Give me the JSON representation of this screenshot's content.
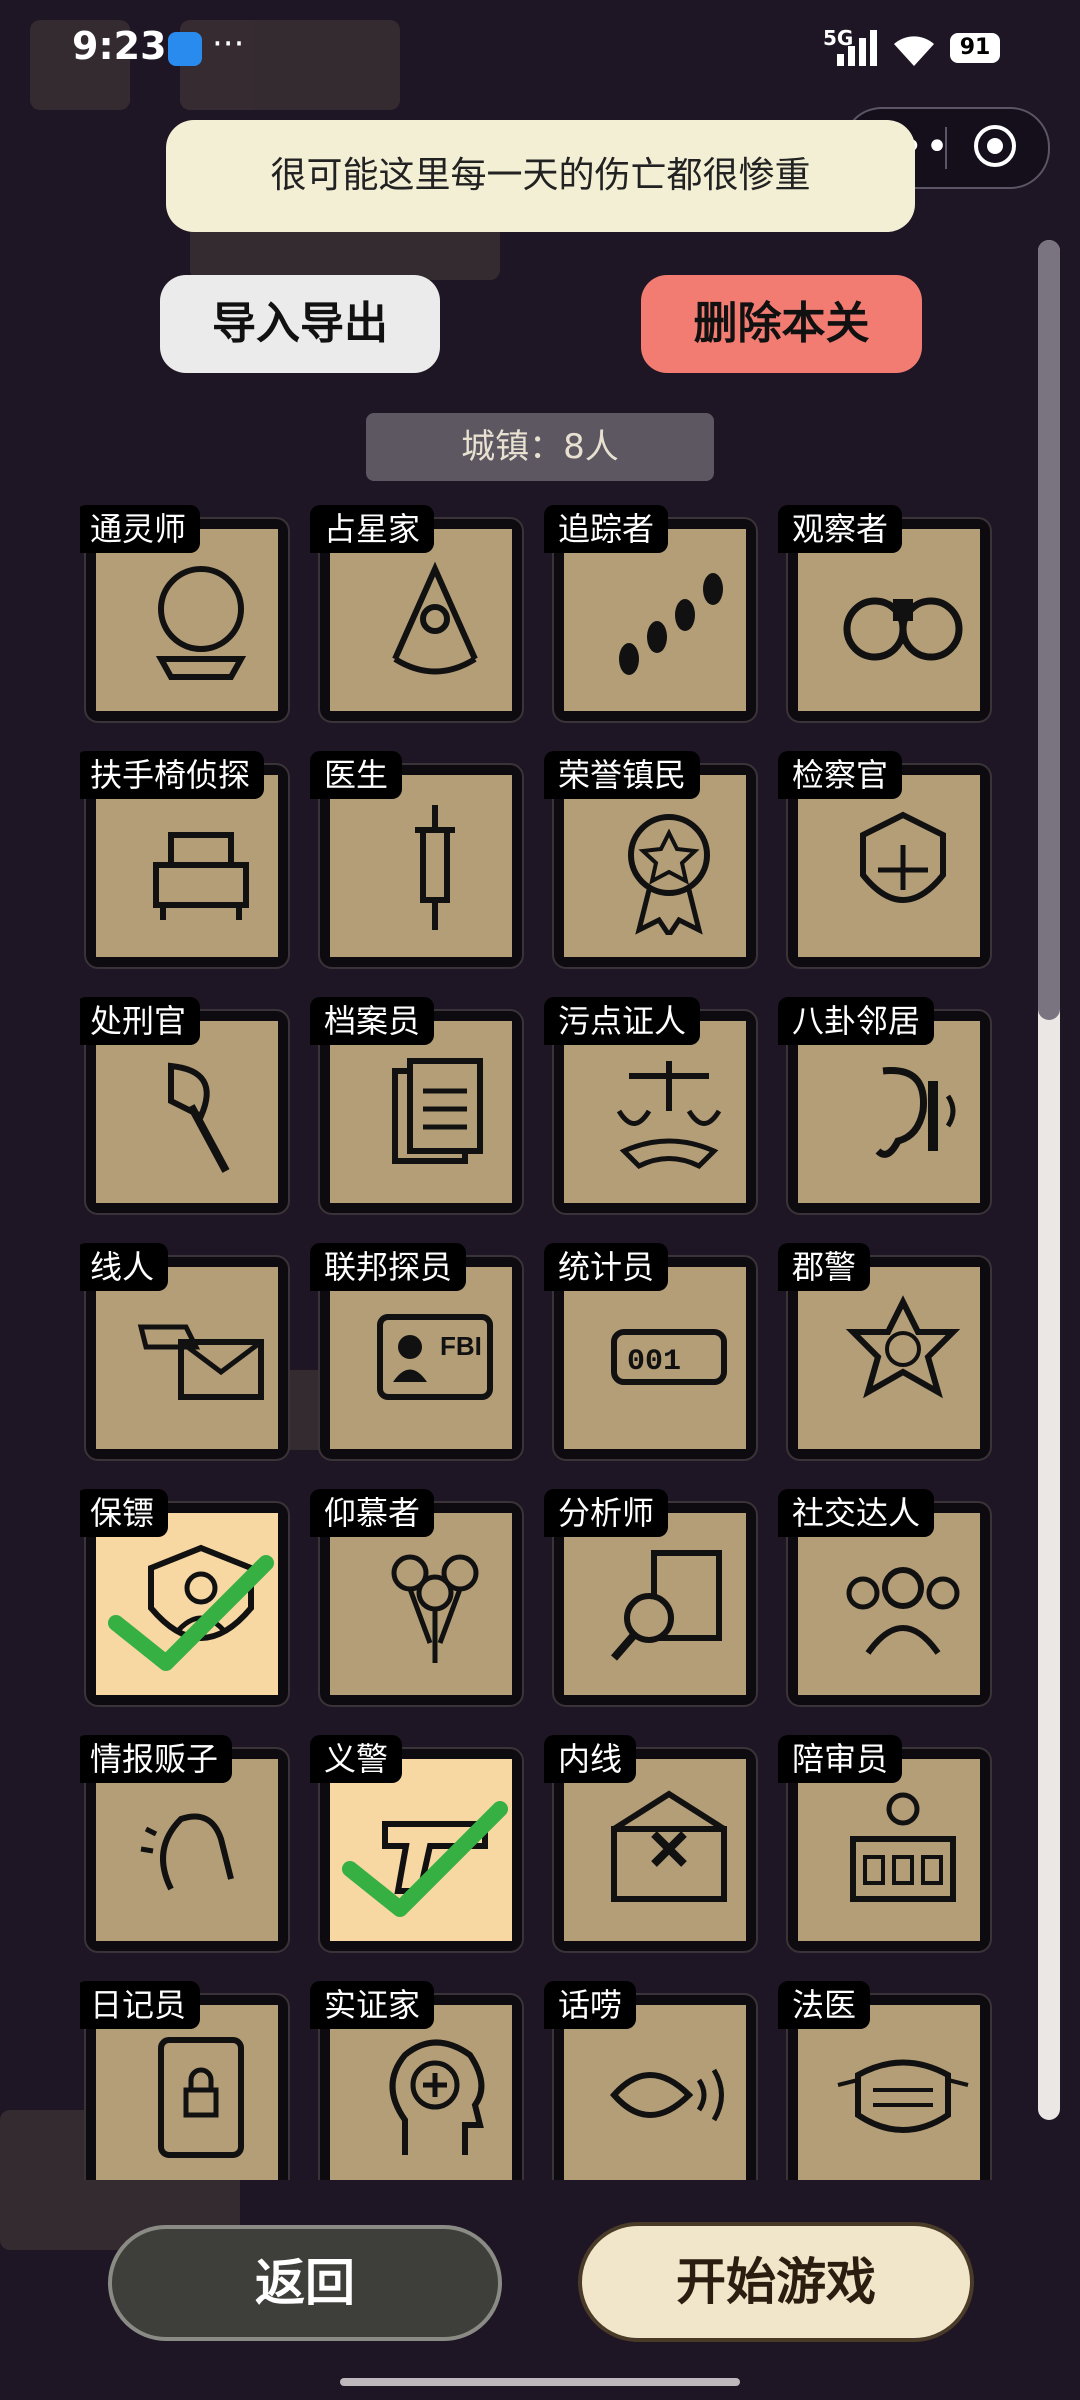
{
  "status_bar": {
    "time": "9:23",
    "network": "5G",
    "battery": "91"
  },
  "toast": "很可能这里每一天的伤亡都很惨重",
  "buttons": {
    "import_export": "导入导出",
    "delete_level": "删除本关",
    "back": "返回",
    "start_game": "开始游戏"
  },
  "town_count": "城镇：8人",
  "roles": [
    {
      "label": "通灵师",
      "icon": "crystal-ball-icon",
      "selected": false
    },
    {
      "label": "占星家",
      "icon": "sextant-icon",
      "selected": false
    },
    {
      "label": "追踪者",
      "icon": "footprints-icon",
      "selected": false
    },
    {
      "label": "观察者",
      "icon": "binoculars-icon",
      "selected": false
    },
    {
      "label": "扶手椅侦探",
      "icon": "armchair-icon",
      "selected": false
    },
    {
      "label": "医生",
      "icon": "syringe-icon",
      "selected": false
    },
    {
      "label": "荣誉镇民",
      "icon": "medal-icon",
      "selected": false
    },
    {
      "label": "检察官",
      "icon": "justice-emblem-icon",
      "selected": false
    },
    {
      "label": "处刑官",
      "icon": "axe-icon",
      "selected": false
    },
    {
      "label": "档案员",
      "icon": "documents-icon",
      "selected": false
    },
    {
      "label": "污点证人",
      "icon": "scales-handshake-icon",
      "selected": false
    },
    {
      "label": "八卦邻居",
      "icon": "ear-wall-icon",
      "selected": false
    },
    {
      "label": "线人",
      "icon": "envelope-hand-icon",
      "selected": false
    },
    {
      "label": "联邦探员",
      "icon": "fbi-badge-icon",
      "selected": false
    },
    {
      "label": "统计员",
      "icon": "counter-icon",
      "selected": false
    },
    {
      "label": "郡警",
      "icon": "sheriff-star-icon",
      "selected": false
    },
    {
      "label": "保镖",
      "icon": "shield-person-icon",
      "selected": true
    },
    {
      "label": "仰慕者",
      "icon": "roses-icon",
      "selected": false
    },
    {
      "label": "分析师",
      "icon": "magnifier-docs-icon",
      "selected": false
    },
    {
      "label": "社交达人",
      "icon": "people-group-icon",
      "selected": false
    },
    {
      "label": "情报贩子",
      "icon": "whisper-icon",
      "selected": false
    },
    {
      "label": "义警",
      "icon": "pistol-icon",
      "selected": true
    },
    {
      "label": "内线",
      "icon": "envelope-x-icon",
      "selected": false
    },
    {
      "label": "陪审员",
      "icon": "jury-box-icon",
      "selected": false
    },
    {
      "label": "日记员",
      "icon": "locked-diary-icon",
      "selected": false
    },
    {
      "label": "实证家",
      "icon": "head-plus-icon",
      "selected": false
    },
    {
      "label": "话唠",
      "icon": "talking-mouth-icon",
      "selected": false
    },
    {
      "label": "法医",
      "icon": "face-mask-icon",
      "selected": false
    }
  ]
}
